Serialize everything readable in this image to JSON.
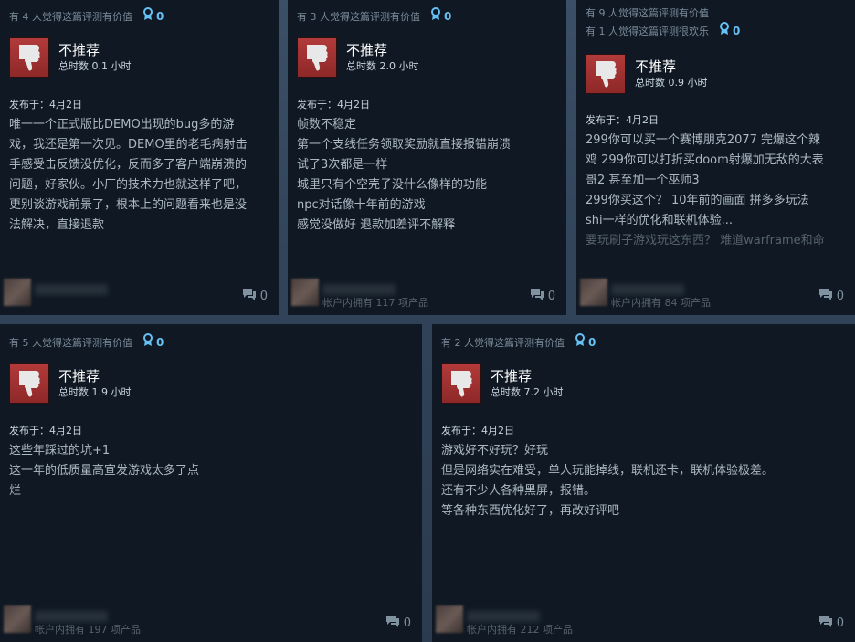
{
  "reviews": [
    {
      "helpful": "有 4 人觉得这篇评测有价值",
      "funny": "",
      "awards": "0",
      "verdict": "不推荐",
      "hours": "总时数 0.1 小时",
      "posted": "发布于：4月2日",
      "lines": [
        "唯一一个正式版比DEMO出现的bug多的游",
        "戏，我还是第一次见。DEMO里的老毛病射击",
        "手感受击反馈没优化，反而多了客户端崩溃的",
        "问题，好家伙。小厂的技术力也就这样了吧，",
        "更别谈游戏前景了，根本上的问题看来也是没",
        "法解决，直接退款"
      ],
      "faded_line": "",
      "owned": "",
      "comments": "0"
    },
    {
      "helpful": "有 3 人觉得这篇评测有价值",
      "funny": "",
      "awards": "0",
      "verdict": "不推荐",
      "hours": "总时数 2.0 小时",
      "posted": "发布于：4月2日",
      "lines": [
        "帧数不稳定",
        "第一个支线任务领取奖励就直接报错崩溃",
        "试了3次都是一样",
        "城里只有个空壳子没什么像样的功能",
        "npc对话像十年前的游戏",
        "感觉没做好 退款加差评不解释"
      ],
      "faded_line": "",
      "owned": "帐户内拥有 117 项产品",
      "comments": "0"
    },
    {
      "helpful": "有 9 人觉得这篇评测有价值",
      "funny": "有 1 人觉得这篇评测很欢乐",
      "awards": "0",
      "verdict": "不推荐",
      "hours": "总时数 0.9 小时",
      "posted": "发布于：4月2日",
      "lines": [
        "299你可以买一个赛博朋克2077 完爆这个辣",
        "鸡 299你可以打折买doom射爆加无敌的大表",
        "哥2 甚至加一个巫师3",
        "299你买这个？ 10年前的画面 拼多多玩法",
        "shi一样的优化和联机体验..."
      ],
      "faded_line": "要玩刷子游戏玩这东西？ 难道warframe和命",
      "owned": "帐户内拥有 84 项产品",
      "comments": "0"
    },
    {
      "helpful": "有 5 人觉得这篇评测有价值",
      "funny": "",
      "awards": "0",
      "verdict": "不推荐",
      "hours": "总时数 1.9 小时",
      "posted": "发布于：4月2日",
      "lines": [
        "这些年踩过的坑+1",
        "这一年的低质量高宣发游戏太多了点",
        "烂"
      ],
      "faded_line": "",
      "owned": "帐户内拥有 197 项产品",
      "comments": "0"
    },
    {
      "helpful": "有 2 人觉得这篇评测有价值",
      "funny": "",
      "awards": "0",
      "verdict": "不推荐",
      "hours": "总时数 7.2 小时",
      "posted": "发布于：4月2日",
      "lines": [
        "游戏好不好玩？好玩",
        "但是网络实在难受，单人玩能掉线，联机还卡，联机体验极差。",
        "还有不少人各种黑屏，报错。",
        "等各种东西优化好了，再改好评吧"
      ],
      "faded_line": "",
      "owned": "帐户内拥有 212 项产品",
      "comments": "0"
    }
  ]
}
